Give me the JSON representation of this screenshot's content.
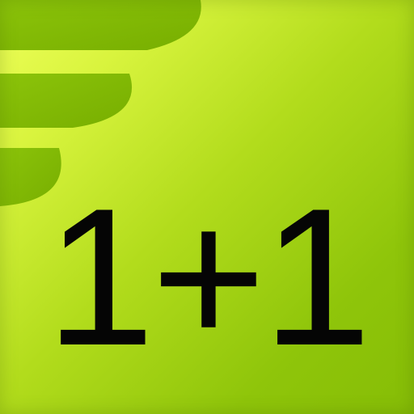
{
  "icon": {
    "label": "1+1",
    "graphic": "green-stripes-decoration",
    "colors": {
      "background_light": "#efff5a",
      "background_dark": "#86bd06",
      "stripe": "#80b800",
      "text": "#050505"
    }
  }
}
